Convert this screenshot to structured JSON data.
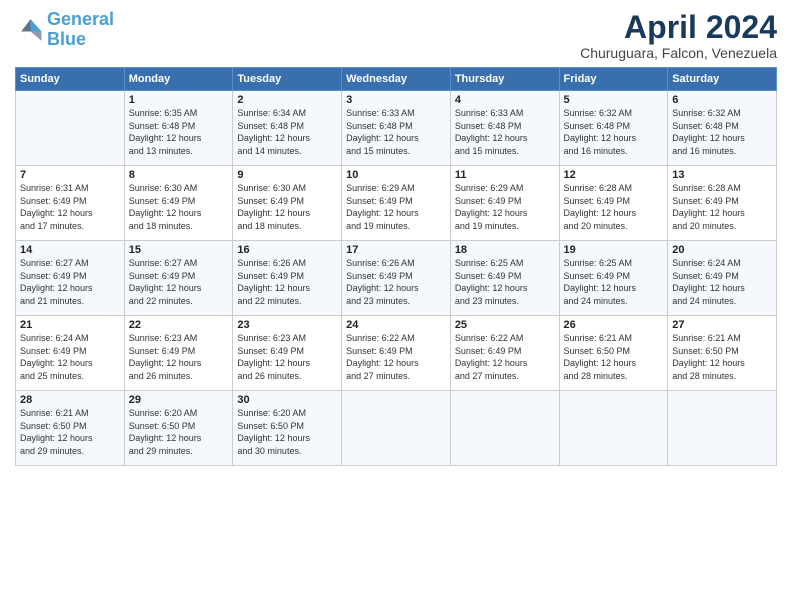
{
  "logo": {
    "line1": "General",
    "line2": "Blue"
  },
  "title": "April 2024",
  "location": "Churuguara, Falcon, Venezuela",
  "days_of_week": [
    "Sunday",
    "Monday",
    "Tuesday",
    "Wednesday",
    "Thursday",
    "Friday",
    "Saturday"
  ],
  "weeks": [
    [
      {
        "num": "",
        "info": ""
      },
      {
        "num": "1",
        "info": "Sunrise: 6:35 AM\nSunset: 6:48 PM\nDaylight: 12 hours\nand 13 minutes."
      },
      {
        "num": "2",
        "info": "Sunrise: 6:34 AM\nSunset: 6:48 PM\nDaylight: 12 hours\nand 14 minutes."
      },
      {
        "num": "3",
        "info": "Sunrise: 6:33 AM\nSunset: 6:48 PM\nDaylight: 12 hours\nand 15 minutes."
      },
      {
        "num": "4",
        "info": "Sunrise: 6:33 AM\nSunset: 6:48 PM\nDaylight: 12 hours\nand 15 minutes."
      },
      {
        "num": "5",
        "info": "Sunrise: 6:32 AM\nSunset: 6:48 PM\nDaylight: 12 hours\nand 16 minutes."
      },
      {
        "num": "6",
        "info": "Sunrise: 6:32 AM\nSunset: 6:48 PM\nDaylight: 12 hours\nand 16 minutes."
      }
    ],
    [
      {
        "num": "7",
        "info": "Sunrise: 6:31 AM\nSunset: 6:49 PM\nDaylight: 12 hours\nand 17 minutes."
      },
      {
        "num": "8",
        "info": "Sunrise: 6:30 AM\nSunset: 6:49 PM\nDaylight: 12 hours\nand 18 minutes."
      },
      {
        "num": "9",
        "info": "Sunrise: 6:30 AM\nSunset: 6:49 PM\nDaylight: 12 hours\nand 18 minutes."
      },
      {
        "num": "10",
        "info": "Sunrise: 6:29 AM\nSunset: 6:49 PM\nDaylight: 12 hours\nand 19 minutes."
      },
      {
        "num": "11",
        "info": "Sunrise: 6:29 AM\nSunset: 6:49 PM\nDaylight: 12 hours\nand 19 minutes."
      },
      {
        "num": "12",
        "info": "Sunrise: 6:28 AM\nSunset: 6:49 PM\nDaylight: 12 hours\nand 20 minutes."
      },
      {
        "num": "13",
        "info": "Sunrise: 6:28 AM\nSunset: 6:49 PM\nDaylight: 12 hours\nand 20 minutes."
      }
    ],
    [
      {
        "num": "14",
        "info": "Sunrise: 6:27 AM\nSunset: 6:49 PM\nDaylight: 12 hours\nand 21 minutes."
      },
      {
        "num": "15",
        "info": "Sunrise: 6:27 AM\nSunset: 6:49 PM\nDaylight: 12 hours\nand 22 minutes."
      },
      {
        "num": "16",
        "info": "Sunrise: 6:26 AM\nSunset: 6:49 PM\nDaylight: 12 hours\nand 22 minutes."
      },
      {
        "num": "17",
        "info": "Sunrise: 6:26 AM\nSunset: 6:49 PM\nDaylight: 12 hours\nand 23 minutes."
      },
      {
        "num": "18",
        "info": "Sunrise: 6:25 AM\nSunset: 6:49 PM\nDaylight: 12 hours\nand 23 minutes."
      },
      {
        "num": "19",
        "info": "Sunrise: 6:25 AM\nSunset: 6:49 PM\nDaylight: 12 hours\nand 24 minutes."
      },
      {
        "num": "20",
        "info": "Sunrise: 6:24 AM\nSunset: 6:49 PM\nDaylight: 12 hours\nand 24 minutes."
      }
    ],
    [
      {
        "num": "21",
        "info": "Sunrise: 6:24 AM\nSunset: 6:49 PM\nDaylight: 12 hours\nand 25 minutes."
      },
      {
        "num": "22",
        "info": "Sunrise: 6:23 AM\nSunset: 6:49 PM\nDaylight: 12 hours\nand 26 minutes."
      },
      {
        "num": "23",
        "info": "Sunrise: 6:23 AM\nSunset: 6:49 PM\nDaylight: 12 hours\nand 26 minutes."
      },
      {
        "num": "24",
        "info": "Sunrise: 6:22 AM\nSunset: 6:49 PM\nDaylight: 12 hours\nand 27 minutes."
      },
      {
        "num": "25",
        "info": "Sunrise: 6:22 AM\nSunset: 6:49 PM\nDaylight: 12 hours\nand 27 minutes."
      },
      {
        "num": "26",
        "info": "Sunrise: 6:21 AM\nSunset: 6:50 PM\nDaylight: 12 hours\nand 28 minutes."
      },
      {
        "num": "27",
        "info": "Sunrise: 6:21 AM\nSunset: 6:50 PM\nDaylight: 12 hours\nand 28 minutes."
      }
    ],
    [
      {
        "num": "28",
        "info": "Sunrise: 6:21 AM\nSunset: 6:50 PM\nDaylight: 12 hours\nand 29 minutes."
      },
      {
        "num": "29",
        "info": "Sunrise: 6:20 AM\nSunset: 6:50 PM\nDaylight: 12 hours\nand 29 minutes."
      },
      {
        "num": "30",
        "info": "Sunrise: 6:20 AM\nSunset: 6:50 PM\nDaylight: 12 hours\nand 30 minutes."
      },
      {
        "num": "",
        "info": ""
      },
      {
        "num": "",
        "info": ""
      },
      {
        "num": "",
        "info": ""
      },
      {
        "num": "",
        "info": ""
      }
    ]
  ]
}
